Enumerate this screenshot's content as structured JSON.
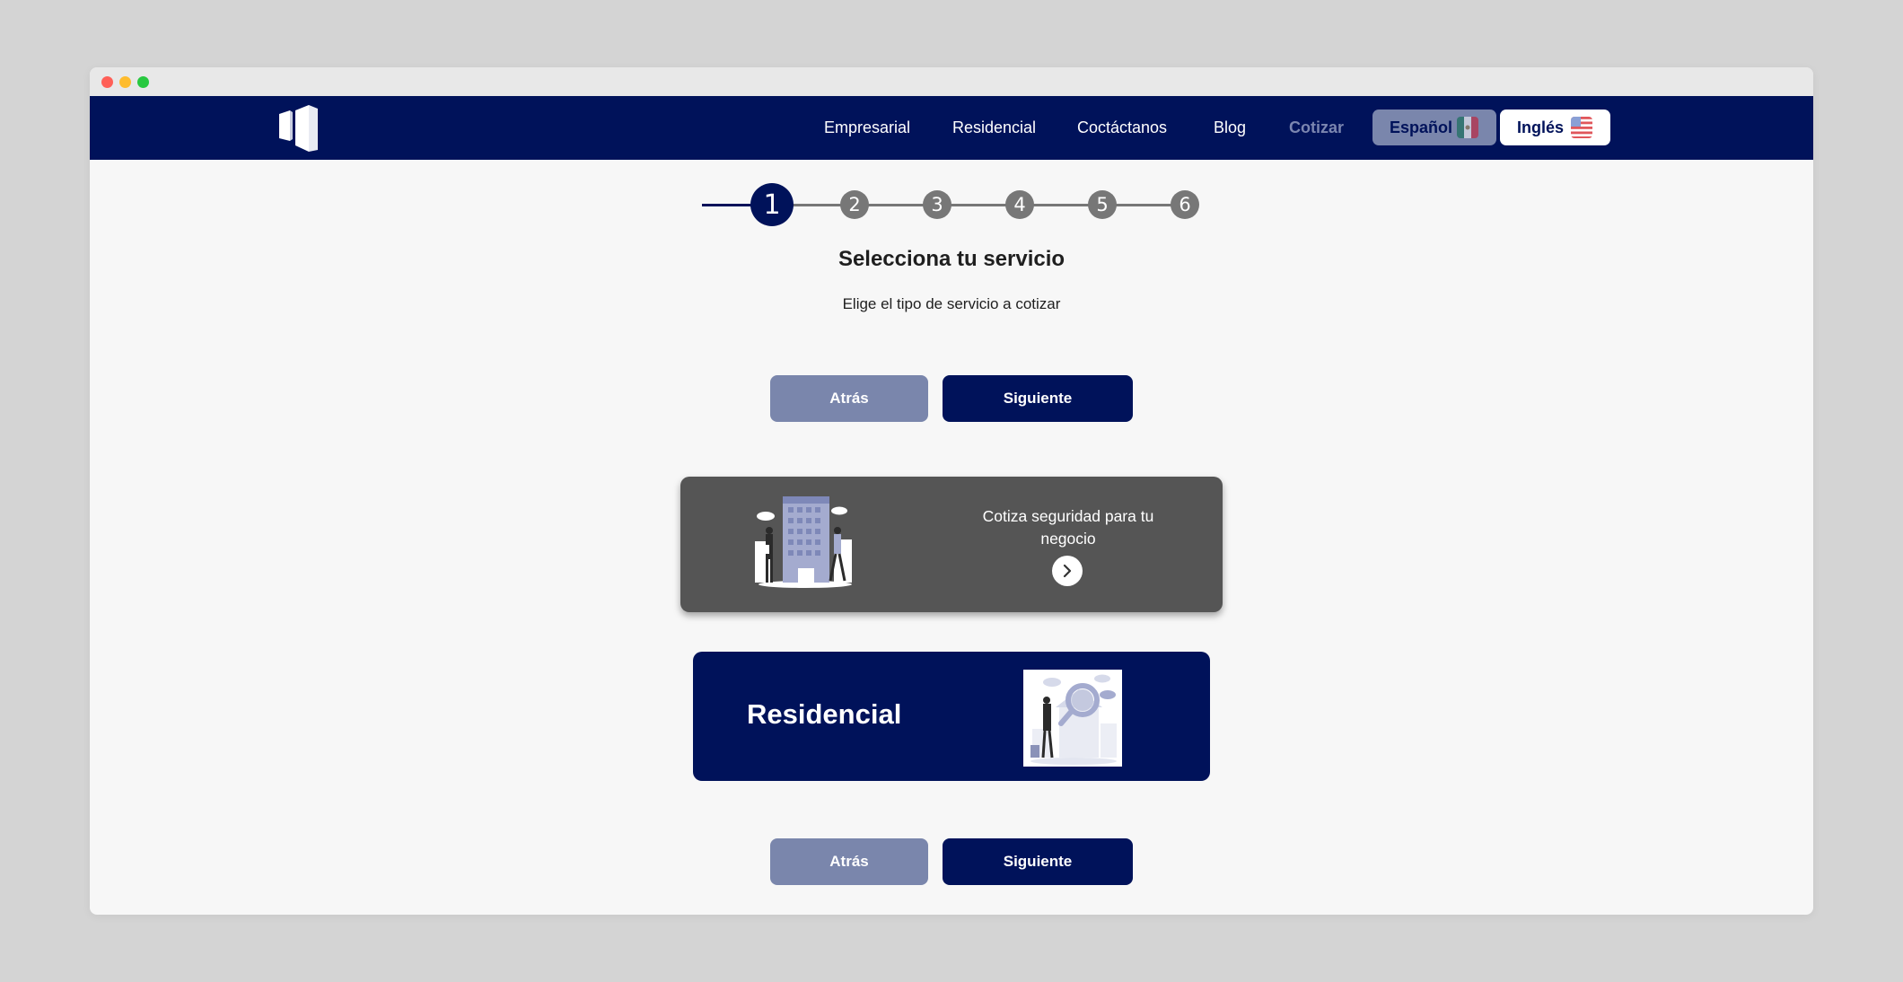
{
  "colors": {
    "primary": "#00125a",
    "muted": "#7a86ac",
    "card_dark": "#555555",
    "step_pending": "#777777",
    "page_bg": "#f7f7f7"
  },
  "nav": {
    "logo_icon": "logo-icon",
    "links": [
      "Empresarial",
      "Residencial",
      "Coctáctanos",
      "Blog",
      "Cotizar"
    ],
    "lang_es": "Español",
    "lang_en": "Inglés"
  },
  "stepper": {
    "current": 1,
    "steps": [
      "1",
      "2",
      "3",
      "4",
      "5",
      "6"
    ]
  },
  "main": {
    "title": "Selecciona tu servicio",
    "subtitle": "Elige el tipo de servicio a cotizar",
    "back_label": "Atrás",
    "next_label": "Siguiente"
  },
  "cards": {
    "business": {
      "text": "Cotiza seguridad para tu negocio",
      "arrow_icon": "chevron-right-icon"
    },
    "residential": {
      "label": "Residencial"
    }
  }
}
